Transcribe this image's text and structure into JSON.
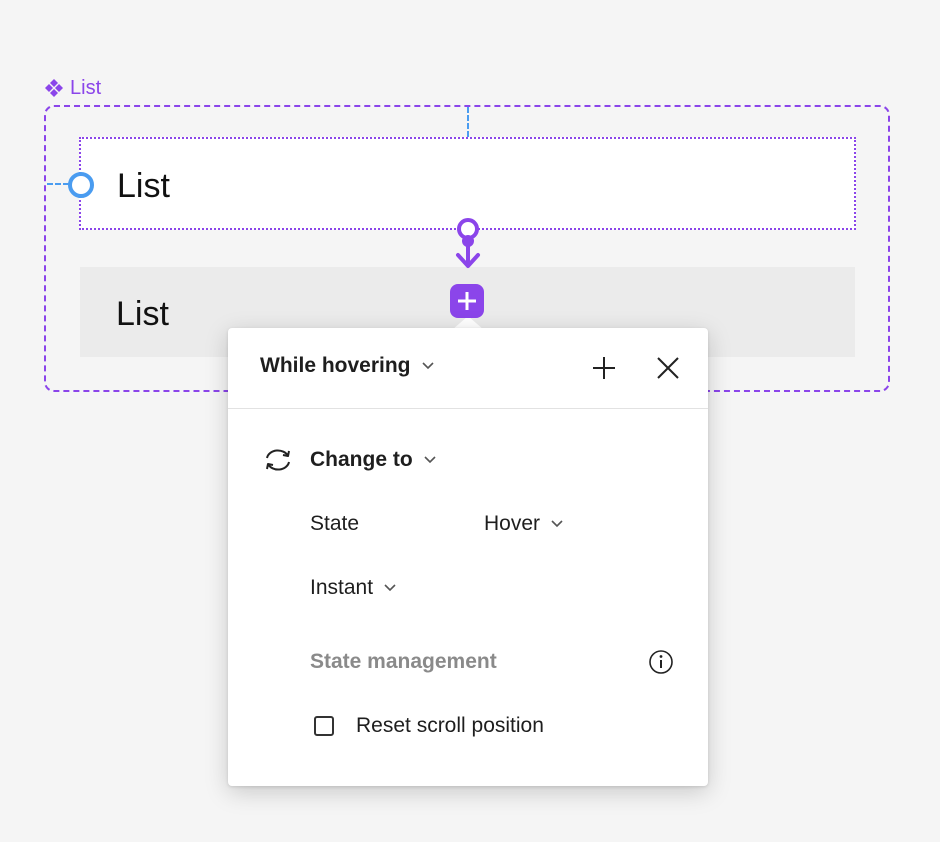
{
  "canvas": {
    "component_name": "List",
    "items": [
      {
        "label": "List"
      },
      {
        "label": "List"
      }
    ]
  },
  "panel": {
    "trigger": "While hovering",
    "action": "Change to",
    "state_label": "State",
    "state_value": "Hover",
    "transition": "Instant",
    "section_title": "State management",
    "reset_scroll_label": "Reset scroll position",
    "reset_scroll_checked": false
  },
  "colors": {
    "accent": "#8b45ea",
    "guide": "#4a9cf0"
  },
  "icons": {
    "component": "component-diamond-icon",
    "add": "plus-icon",
    "close": "close-icon",
    "action": "swap-arrows-icon",
    "info": "info-icon"
  }
}
